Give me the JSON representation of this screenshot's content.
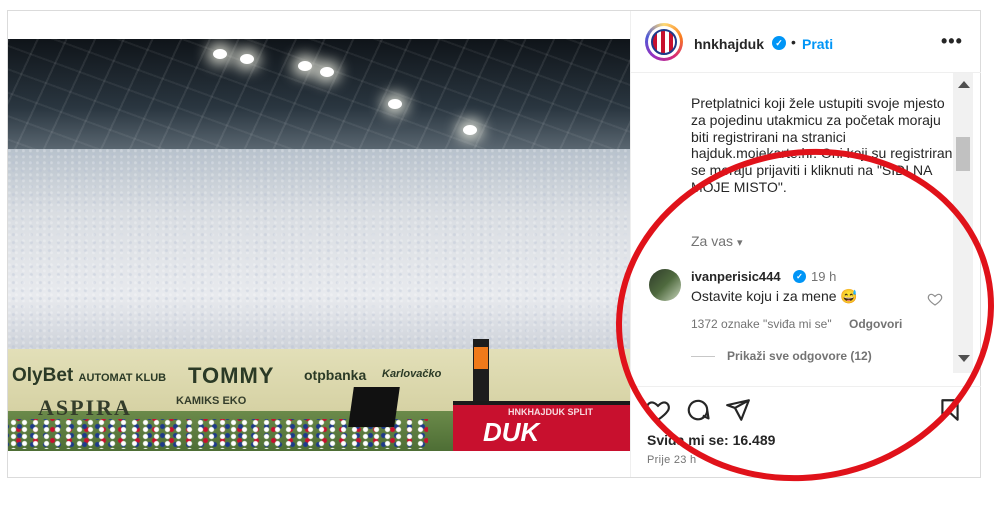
{
  "post": {
    "username": "hnkhajduk",
    "dot": "•",
    "follow_label": "Prati",
    "more_label": "•••",
    "caption": "Pretplatnici koji žele ustupiti svoje mjesto za pojedinu utakmicu za početak moraju biti registrirani na stranici hajduk.mojekarte.hr. Oni koji su registrirani se moraju prijaviti i kliknuti na \"SIDI NA MOJE MISTO\".",
    "translation_toggle": "Za vas",
    "likes_text": "Sviđa mi se: 16.489",
    "posted_ago": "Prije 23 h"
  },
  "photo": {
    "board_olybet": "OlyBet",
    "board_olybet_sub": "AUTOMAT KLUB",
    "board_tommy": "TOMMY",
    "board_otp": "otpbanka",
    "board_karlovacko": "Karlovačko",
    "board_aspira": "ASPIRA",
    "board_kamiks": "KAMIKS EKO",
    "red_board": "DUK",
    "watermark": "HNKHAJDUK SPLIT"
  },
  "comment": {
    "username": "ivanperisic444",
    "time": "19 h",
    "text": "Ostavite koju i za mene 😅",
    "likes": "1372 oznake \"sviđa mi se\"",
    "reply_label": "Odgovori",
    "view_replies": "Prikaži sve odgovore (12)"
  },
  "colors": {
    "accent_blue": "#0095f6",
    "highlight_red": "#e0121a",
    "text_primary": "#262626",
    "text_secondary": "#737373"
  },
  "icons": [
    "heart-icon",
    "comment-icon",
    "share-icon",
    "bookmark-icon",
    "verified-badge-icon",
    "chevron-down-icon"
  ]
}
